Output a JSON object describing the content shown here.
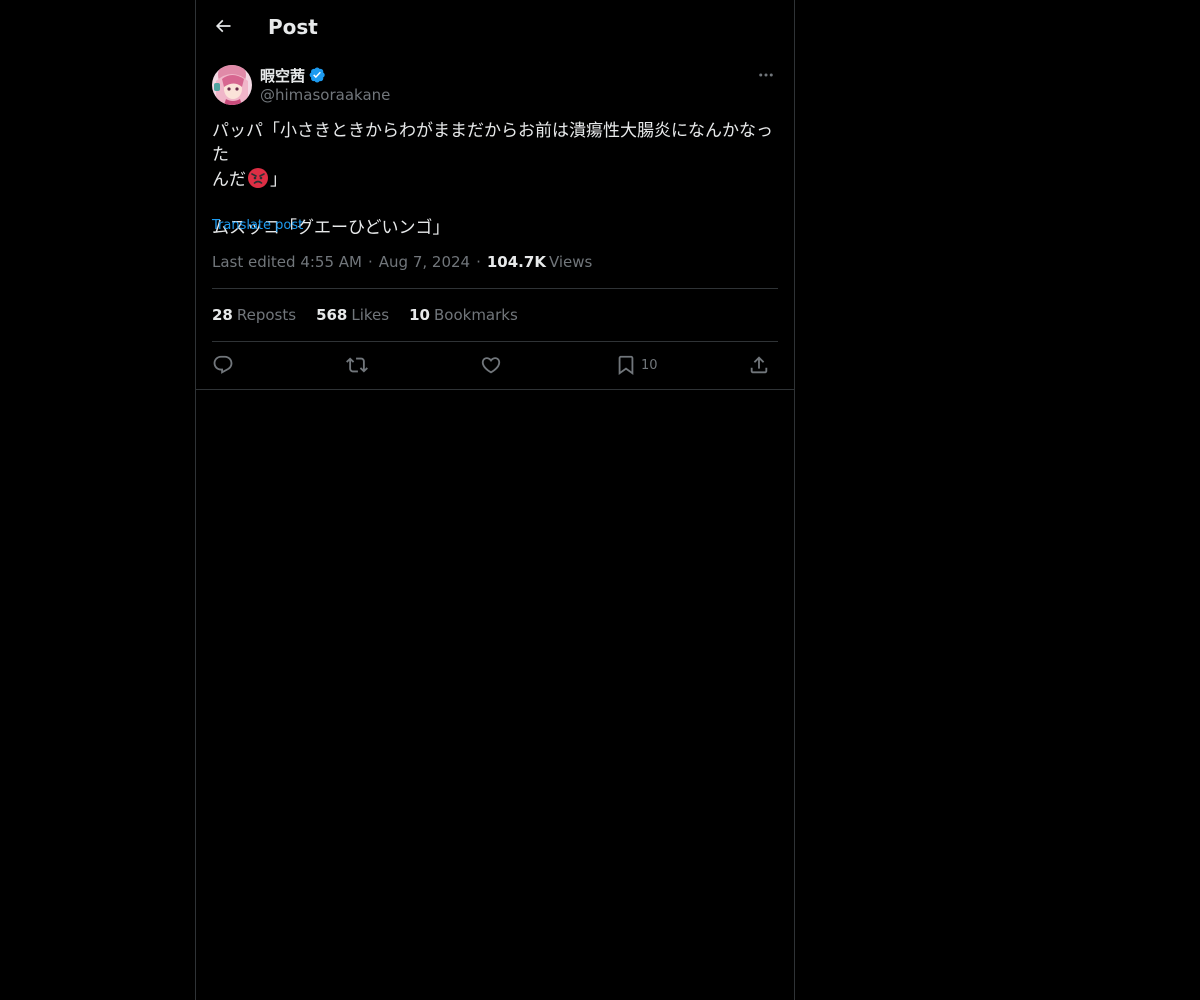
{
  "header": {
    "back_icon": "arrow-left-icon",
    "title": "Post"
  },
  "author": {
    "display_name": "暇空茜",
    "handle": "@himasoraakane",
    "verified": true,
    "verified_color": "#1d9bf0"
  },
  "post": {
    "lines": [
      "パッパ「小さきときからわがままだからお前は潰瘍性大腸炎になんかなった",
      "んだ",
      "」",
      "ムスッコ「グエーひどいンゴ」"
    ],
    "emoji": "angry-face",
    "translate_label": "Translate post"
  },
  "meta": {
    "edited_label": "Last edited 4:55 AM",
    "date": "Aug 7, 2024",
    "views_count": "104.7K",
    "views_label": "Views"
  },
  "stats": {
    "reposts_count": "28",
    "reposts_label": "Reposts",
    "likes_count": "568",
    "likes_label": "Likes",
    "bookmarks_count": "10",
    "bookmarks_label": "Bookmarks"
  },
  "actions": {
    "reply_icon": "reply-icon",
    "repost_icon": "repost-icon",
    "like_icon": "heart-icon",
    "bookmark_icon": "bookmark-icon",
    "bookmark_count": "10",
    "share_icon": "share-icon"
  },
  "colors": {
    "background": "#000000",
    "text": "#e7e9ea",
    "secondary": "#71767b",
    "accent": "#1d9bf0",
    "border": "#2f3336"
  }
}
